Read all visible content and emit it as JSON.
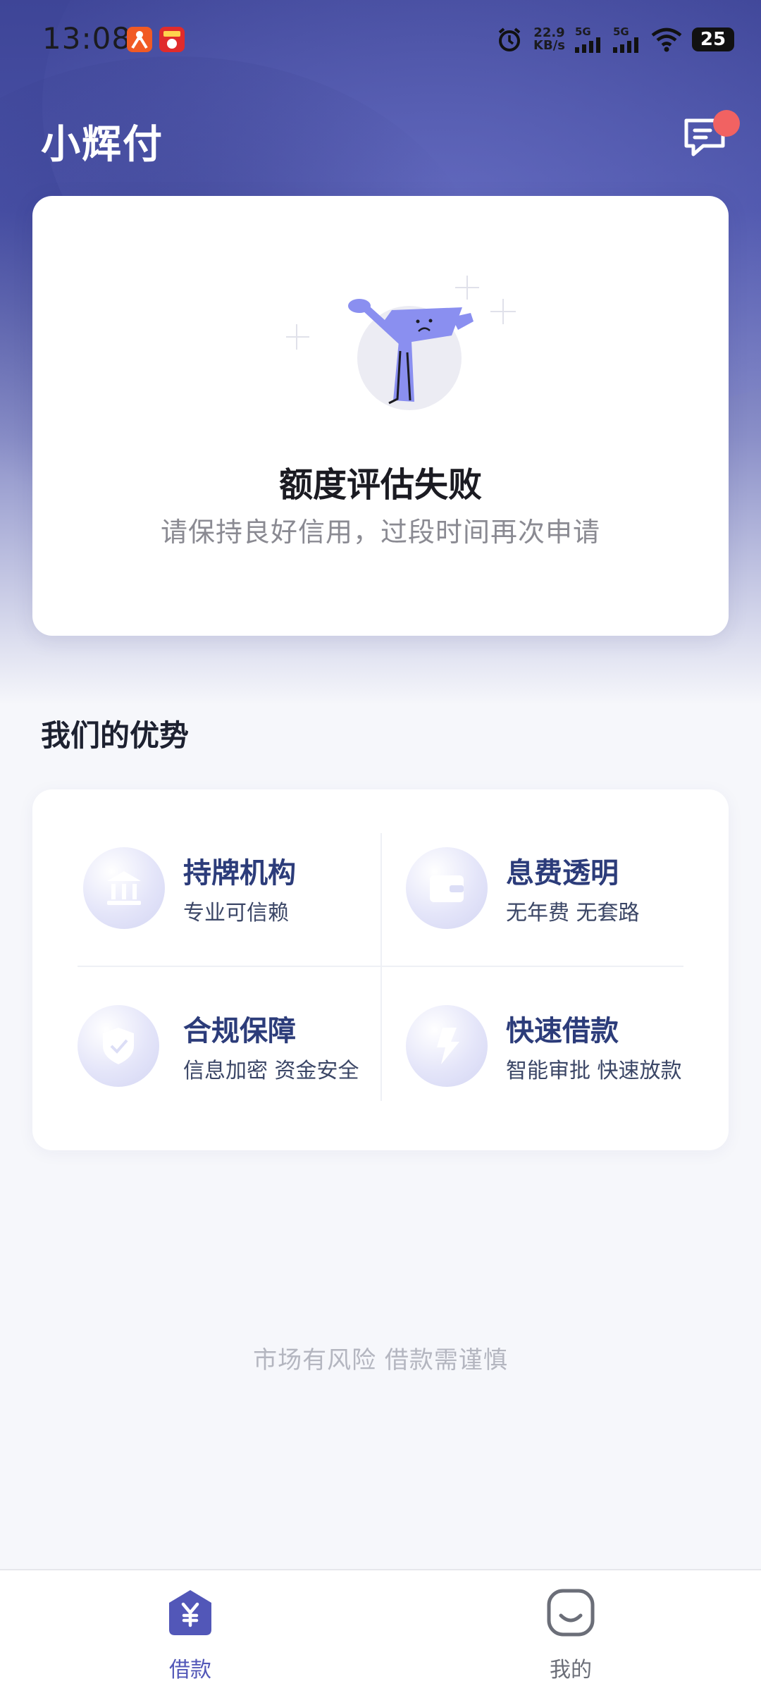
{
  "status_bar": {
    "time": "13:08",
    "net_speed_value": "22.9",
    "net_speed_unit": "KB/s",
    "sim1": "5G",
    "sim2": "5G",
    "battery": "25"
  },
  "header": {
    "title": "小辉付",
    "message_icon": "chat-message-icon"
  },
  "result": {
    "title": "额度评估失败",
    "subtitle": "请保持良好信用，过段时间再次申请"
  },
  "advantages": {
    "section_title": "我们的优势",
    "items": [
      {
        "title": "持牌机构",
        "subtitle": "专业可信赖",
        "icon": "bank-icon"
      },
      {
        "title": "息费透明",
        "subtitle": "无年费 无套路",
        "icon": "wallet-icon"
      },
      {
        "title": "合规保障",
        "subtitle": "信息加密 资金安全",
        "icon": "shield-icon"
      },
      {
        "title": "快速借款",
        "subtitle": "智能审批 快速放款",
        "icon": "lightning-icon"
      }
    ]
  },
  "disclaimer": "市场有风险 借款需谨慎",
  "bottom_nav": {
    "items": [
      {
        "label": "借款",
        "icon": "yuan-home-icon",
        "active": true
      },
      {
        "label": "我的",
        "icon": "smile-face-icon",
        "active": false
      }
    ]
  },
  "colors": {
    "accent": "#5257b8",
    "nav_inactive": "#6b6e78",
    "advantage_title": "#2c3c7a",
    "badge_red": "#f16262"
  }
}
